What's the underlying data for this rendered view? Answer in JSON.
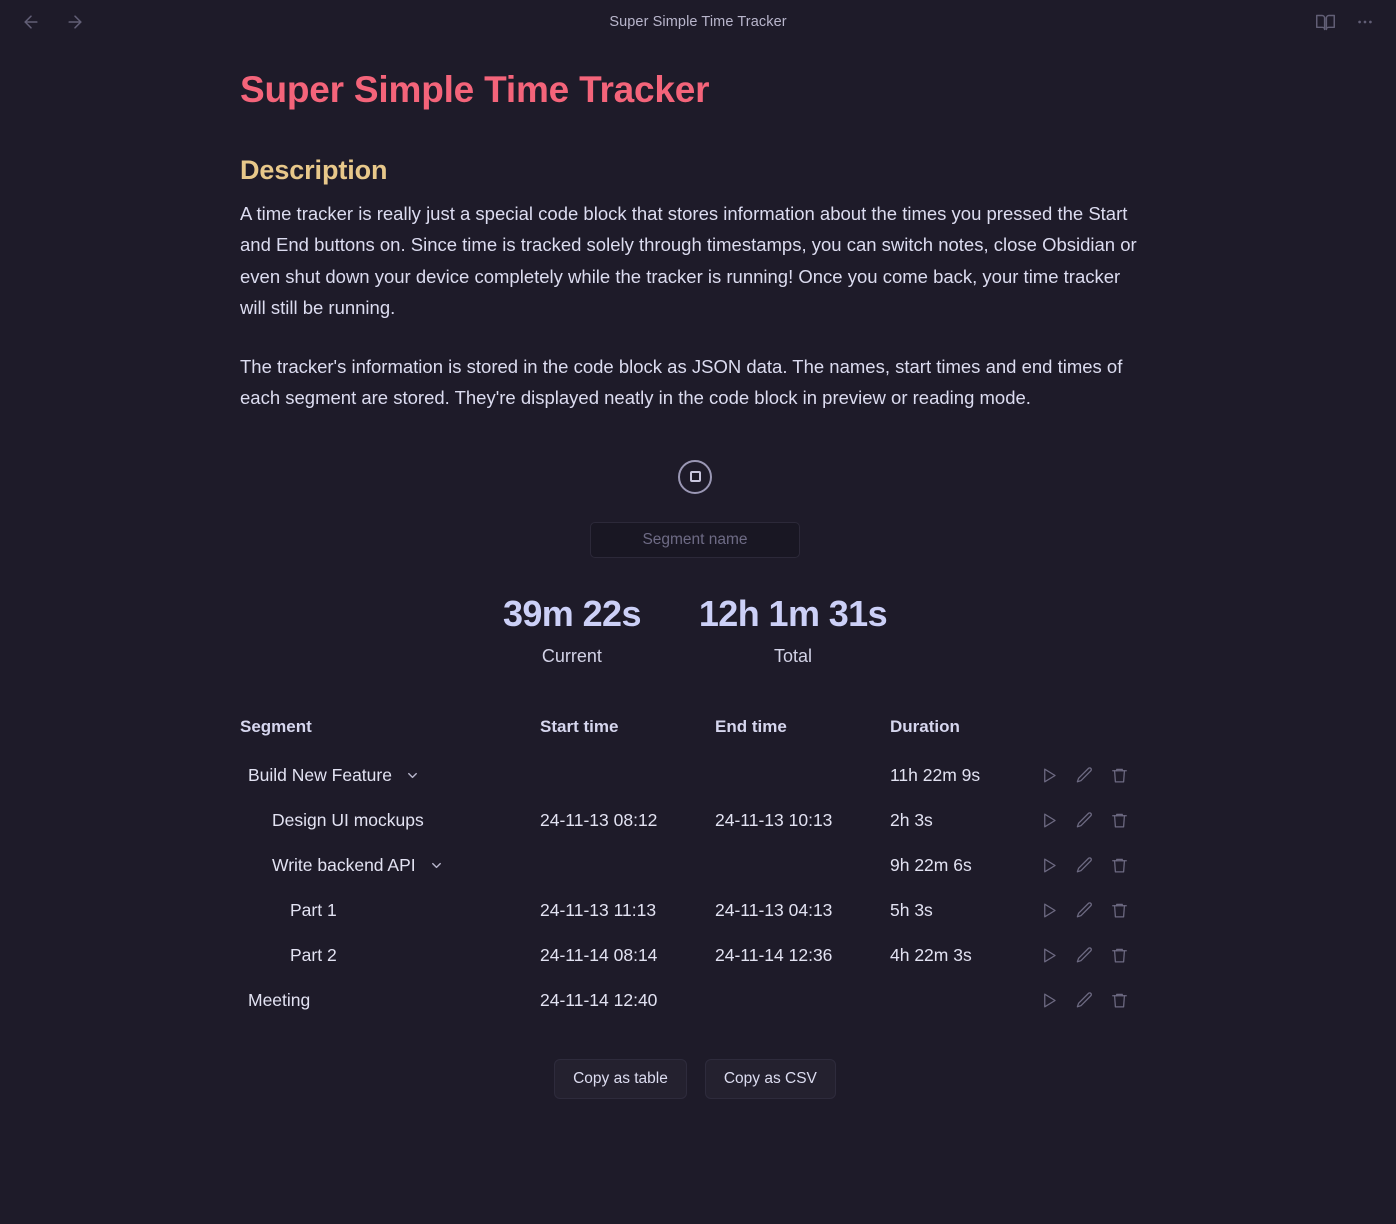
{
  "titlebar": {
    "title": "Super Simple Time Tracker",
    "back_icon": "arrow-left-icon",
    "forward_icon": "arrow-right-icon",
    "reading_view_icon": "open-book-icon",
    "more_options_icon": "more-options-icon"
  },
  "note": {
    "title": "Super Simple Time Tracker",
    "section_heading": "Description",
    "paragraph_1": "A time tracker is really just a special code block that stores information about the times you pressed the Start and End buttons on. Since time is tracked solely through timestamps, you can switch notes, close Obsidian or even shut down your device completely while the tracker is running! Once you come back, your time tracker will still be running.",
    "paragraph_2": "The tracker's information is stored in the code block as JSON data. The names, start times and end times of each segment are stored. They're displayed neatly in the code block in preview or reading mode."
  },
  "tracker": {
    "stop_button_icon": "stop-icon",
    "segment_name_input": {
      "value": "",
      "placeholder": "Segment name"
    },
    "current": {
      "value": "39m 22s",
      "label": "Current"
    },
    "total": {
      "value": "12h 1m 31s",
      "label": "Total"
    },
    "columns": [
      "Segment",
      "Start time",
      "End time",
      "Duration"
    ],
    "rows": [
      {
        "name": "Build New Feature",
        "depth": 0,
        "collapsible": true,
        "start": "",
        "end": "",
        "duration": "11h 22m 9s"
      },
      {
        "name": "Design UI mockups",
        "depth": 1,
        "collapsible": false,
        "start": "24-11-13 08:12",
        "end": "24-11-13 10:13",
        "duration": "2h 3s"
      },
      {
        "name": "Write backend API",
        "depth": 1,
        "collapsible": true,
        "start": "",
        "end": "",
        "duration": "9h 22m 6s"
      },
      {
        "name": "Part 1",
        "depth": 2,
        "collapsible": false,
        "start": "24-11-13 11:13",
        "end": "24-11-13 04:13",
        "duration": "5h 3s"
      },
      {
        "name": "Part 2",
        "depth": 2,
        "collapsible": false,
        "start": "24-11-14 08:14",
        "end": "24-11-14 12:36",
        "duration": "4h 22m 3s"
      },
      {
        "name": "Meeting",
        "depth": 0,
        "collapsible": false,
        "start": "24-11-14 12:40",
        "end": "",
        "duration": ""
      }
    ],
    "row_actions": {
      "play_icon": "play-icon",
      "edit_icon": "pencil-icon",
      "delete_icon": "trash-icon"
    },
    "footer": {
      "copy_table_label": "Copy as table",
      "copy_csv_label": "Copy as CSV"
    }
  },
  "colors": {
    "background": "#1e1b29",
    "title_accent": "#f4647a",
    "heading_accent": "#e8c88a",
    "body_text": "#dcdcf0",
    "timer_value": "#ccd0f7",
    "muted": "#6d6a82"
  }
}
